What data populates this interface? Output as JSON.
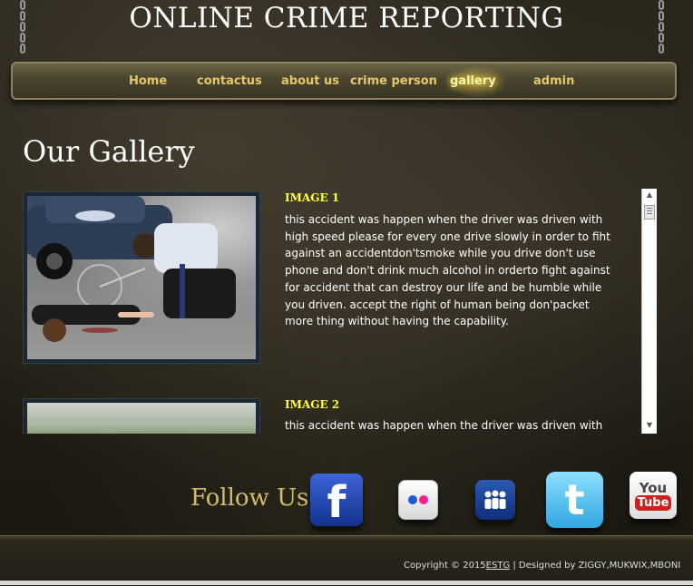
{
  "header": {
    "site_title": "ONLINE CRIME REPORTING"
  },
  "nav": {
    "items": [
      {
        "label": "Home"
      },
      {
        "label": "contactus"
      },
      {
        "label": "about us"
      },
      {
        "label": "crime person"
      },
      {
        "label": "gallery",
        "active": true
      },
      {
        "label": "admin"
      }
    ]
  },
  "gallery": {
    "heading": "Our Gallery",
    "items": [
      {
        "title": "IMAGE 1",
        "description": "this accident was happen when the driver was driven with high speed please for every one drive slowly in order to fiht against an accidentdon'tsmoke while you drive don't use phone and don't drink much alcohol in orderto fight against for accident that can destroy our life and be humble while you driven. accept the right of human being don'packet more thing without having the capability."
      },
      {
        "title": "IMAGE 2",
        "description": "this accident was happen when the driver was driven with"
      }
    ]
  },
  "social": {
    "follow_label": "Follow Us",
    "icons": [
      "facebook-icon",
      "flickr-icon",
      "myspace-icon",
      "twitter-icon",
      "youtube-icon"
    ],
    "facebook_glyph": "f",
    "twitter_glyph": "t",
    "youtube_you": "You",
    "youtube_tube": "Tube"
  },
  "footer": {
    "copyright_prefix": "Copyright © 2015",
    "copyright_link": "ESTG",
    "designed_by": " | Designed by ZIGGY,MUKWIX,MBONI"
  },
  "colors": {
    "nav_text": "#e3c96a",
    "item_title": "#ffff33",
    "follow_text": "#d3bb6e"
  }
}
